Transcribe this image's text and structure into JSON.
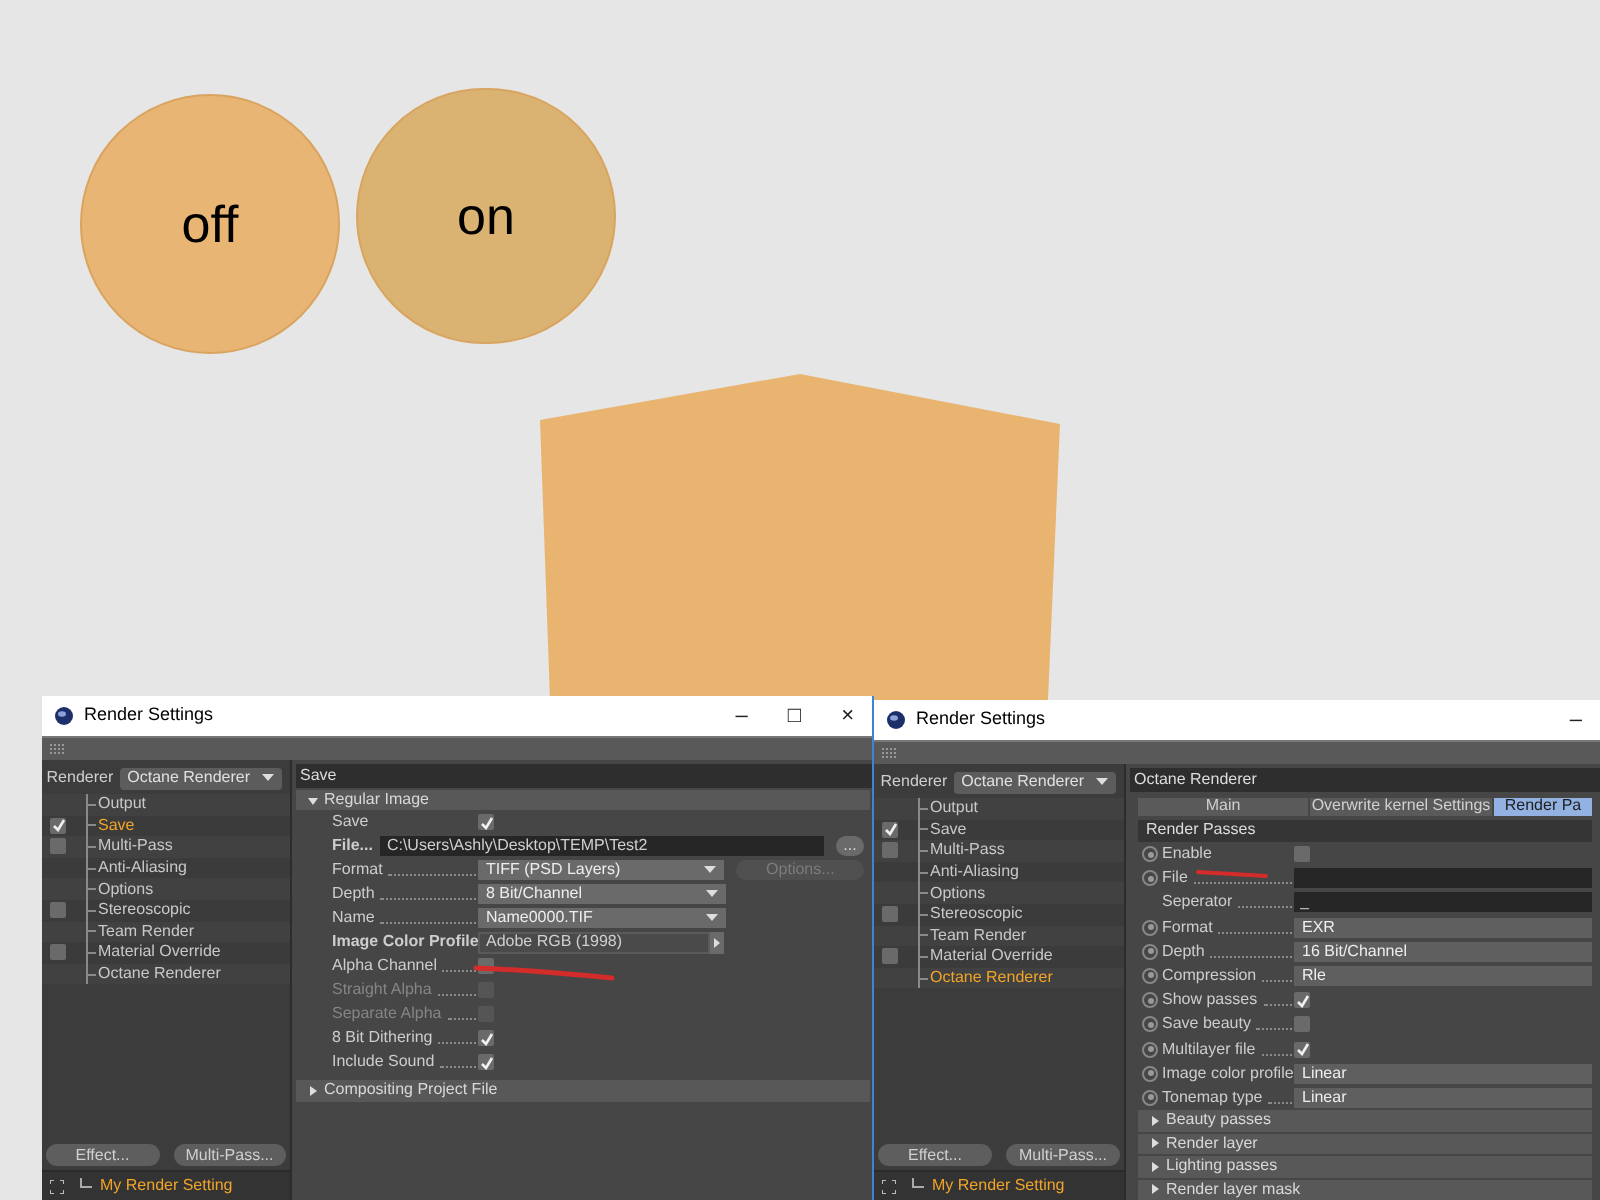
{
  "circles": [
    {
      "label": "off",
      "color": "#e9b574"
    },
    {
      "label": "on",
      "color": "#dab272"
    }
  ],
  "windows": [
    {
      "title": "Render Settings",
      "controls": [
        "–",
        "□",
        "×"
      ],
      "renderer_label": "Renderer",
      "renderer_value": "Octane Renderer",
      "tree": [
        {
          "label": "Output",
          "kind": "plain",
          "selected": false
        },
        {
          "label": "Save",
          "kind": "check",
          "checked": true,
          "selected": true
        },
        {
          "label": "Multi-Pass",
          "kind": "check",
          "checked": false,
          "selected": false
        },
        {
          "label": "Anti-Aliasing",
          "kind": "plain",
          "selected": false
        },
        {
          "label": "Options",
          "kind": "plain",
          "selected": false
        },
        {
          "label": "Stereoscopic",
          "kind": "check",
          "checked": false,
          "selected": false
        },
        {
          "label": "Team Render",
          "kind": "plain",
          "selected": false
        },
        {
          "label": "Material Override",
          "kind": "check",
          "checked": false,
          "selected": false
        },
        {
          "label": "Octane Renderer",
          "kind": "plain",
          "selected": false
        }
      ],
      "buttons": [
        "Effect...",
        "Multi-Pass..."
      ],
      "footer": "My Render Setting",
      "panel": {
        "kind": "save",
        "header": "Save",
        "section": {
          "label": "Regular Image",
          "expanded": true
        },
        "rows": [
          {
            "kind": "check",
            "label": "Save",
            "bold": false,
            "disabled": false,
            "leader": false,
            "checked": true
          },
          {
            "kind": "path",
            "label": "File...",
            "bold": true,
            "disabled": false,
            "leader": false,
            "value": "C:\\Users\\Ashly\\Desktop\\TEMP\\Test2",
            "button": {
              "label": "...",
              "disabled": false
            }
          },
          {
            "kind": "dropdown",
            "label": "Format",
            "bold": false,
            "disabled": false,
            "leader": true,
            "value": "TIFF (PSD Layers)",
            "button": {
              "label": "Options...",
              "disabled": true
            }
          },
          {
            "kind": "dropdown",
            "label": "Depth",
            "bold": false,
            "disabled": false,
            "leader": true,
            "value": "8 Bit/Channel"
          },
          {
            "kind": "dropdown",
            "label": "Name",
            "bold": false,
            "disabled": false,
            "leader": true,
            "value": "Name0000.TIF"
          },
          {
            "kind": "profile",
            "label": "Image Color Profile",
            "bold": true,
            "disabled": false,
            "leader": false,
            "value": "Adobe RGB (1998)"
          },
          {
            "kind": "check",
            "label": "Alpha Channel",
            "bold": false,
            "disabled": false,
            "leader": true,
            "checked": false
          },
          {
            "kind": "check",
            "label": "Straight Alpha",
            "bold": false,
            "disabled": true,
            "leader": true,
            "checked": false
          },
          {
            "kind": "check",
            "label": "Separate Alpha",
            "bold": false,
            "disabled": true,
            "leader": true,
            "checked": false
          },
          {
            "kind": "check",
            "label": "8 Bit Dithering",
            "bold": false,
            "disabled": false,
            "leader": true,
            "checked": true
          },
          {
            "kind": "check",
            "label": "Include Sound",
            "bold": false,
            "disabled": false,
            "leader": true,
            "checked": true
          }
        ],
        "collapsed": [
          {
            "label": "Compositing Project File",
            "expanded": false
          }
        ]
      }
    },
    {
      "title": "Render Settings",
      "controls": [
        "–"
      ],
      "renderer_label": "Renderer",
      "renderer_value": "Octane Renderer",
      "tree": [
        {
          "label": "Output",
          "kind": "plain",
          "selected": false
        },
        {
          "label": "Save",
          "kind": "check",
          "checked": true,
          "selected": false
        },
        {
          "label": "Multi-Pass",
          "kind": "check",
          "checked": false,
          "selected": false
        },
        {
          "label": "Anti-Aliasing",
          "kind": "plain",
          "selected": false
        },
        {
          "label": "Options",
          "kind": "plain",
          "selected": false
        },
        {
          "label": "Stereoscopic",
          "kind": "check",
          "checked": false,
          "selected": false
        },
        {
          "label": "Team Render",
          "kind": "plain",
          "selected": false
        },
        {
          "label": "Material Override",
          "kind": "check",
          "checked": false,
          "selected": false
        },
        {
          "label": "Octane Renderer",
          "kind": "plain",
          "selected": true
        }
      ],
      "buttons": [
        "Effect...",
        "Multi-Pass..."
      ],
      "footer": "My Render Setting",
      "panel": {
        "kind": "octane",
        "header": "Octane Renderer",
        "tabs": [
          {
            "label": "Main",
            "selected": false
          },
          {
            "label": "Overwrite kernel Settings",
            "selected": false
          },
          {
            "label": "Render Pa",
            "selected": true
          }
        ],
        "section": {
          "label": "Render Passes"
        },
        "rows": [
          {
            "kind": "check",
            "label": "Enable",
            "bold": false,
            "disabled": false,
            "leader": false,
            "radio": true,
            "checked": false
          },
          {
            "kind": "field",
            "label": "File",
            "bold": false,
            "disabled": false,
            "leader": true,
            "radio": true
          },
          {
            "kind": "field",
            "label": "Seperator",
            "bold": false,
            "disabled": false,
            "leader": true,
            "radio": false,
            "value": "_"
          },
          {
            "kind": "choice",
            "label": "Format",
            "bold": false,
            "disabled": false,
            "leader": true,
            "radio": true,
            "value": "EXR"
          },
          {
            "kind": "choice",
            "label": "Depth",
            "bold": false,
            "disabled": false,
            "leader": true,
            "radio": true,
            "value": "16 Bit/Channel"
          },
          {
            "kind": "choice",
            "label": "Compression",
            "bold": false,
            "disabled": false,
            "leader": true,
            "radio": true,
            "value": "Rle"
          },
          {
            "kind": "check",
            "label": "Show passes",
            "bold": false,
            "disabled": false,
            "leader": true,
            "radio": true,
            "checked": true
          },
          {
            "kind": "check",
            "label": "Save beauty",
            "bold": false,
            "disabled": false,
            "leader": true,
            "radio": true,
            "checked": false
          },
          {
            "kind": "check",
            "label": "Multilayer file",
            "bold": false,
            "disabled": false,
            "leader": true,
            "radio": true,
            "checked": true
          },
          {
            "kind": "choice",
            "label": "Image color profile",
            "bold": false,
            "disabled": false,
            "leader": false,
            "radio": true,
            "value": "Linear"
          },
          {
            "kind": "choice",
            "label": "Tonemap type",
            "bold": false,
            "disabled": false,
            "leader": true,
            "radio": true,
            "value": "Linear"
          }
        ],
        "collapsed": [
          {
            "label": "Beauty passes",
            "expanded": false
          },
          {
            "label": "Render layer",
            "expanded": false
          },
          {
            "label": "Lighting passes",
            "expanded": false
          },
          {
            "label": "Render layer mask",
            "expanded": false
          }
        ]
      }
    }
  ]
}
